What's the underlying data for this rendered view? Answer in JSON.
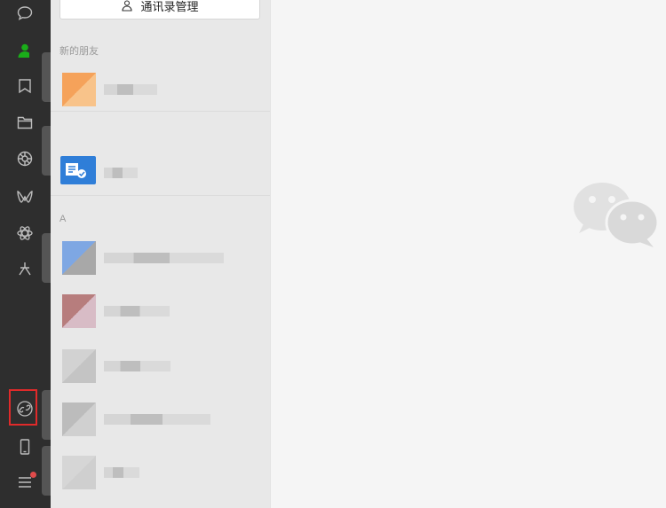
{
  "rail": {
    "icons": [
      "chat-icon",
      "contacts-icon",
      "favorites-icon",
      "files-icon",
      "moments-icon",
      "channels-icon",
      "search-icon",
      "mini-programs-icon",
      "link-icon",
      "phone-icon",
      "menu-icon"
    ],
    "active_color": "#1aad19",
    "highlight_color": "#e02a2a"
  },
  "contacts": {
    "manage_button_label": "通讯录管理",
    "sections": [
      {
        "label": "新的朋友"
      },
      {
        "label": "A"
      }
    ]
  }
}
